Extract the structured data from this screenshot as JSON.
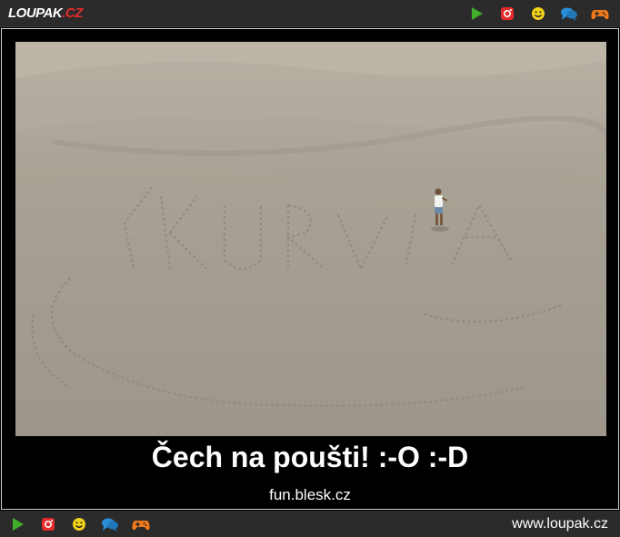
{
  "header": {
    "logo_main": "LOUPAK",
    "logo_tld": ".CZ",
    "icons": [
      "play-icon",
      "instagram-icon",
      "smiley-icon",
      "chat-icon",
      "gamepad-icon"
    ]
  },
  "post": {
    "caption": "Čech na poušti! :-O :-D",
    "source": "fun.blesk.cz"
  },
  "footer": {
    "site": "www.loupak.cz",
    "icons": [
      "play-icon",
      "instagram-icon",
      "smiley-icon",
      "chat-icon",
      "gamepad-icon"
    ]
  },
  "colors": {
    "bar": "#2b2b2b",
    "play": "#3fae2a",
    "instagram": "#e52b2b",
    "smiley": "#f2d21b",
    "chat": "#2a8fd6",
    "gamepad": "#f07a1a",
    "sand": "#a39c8f"
  }
}
